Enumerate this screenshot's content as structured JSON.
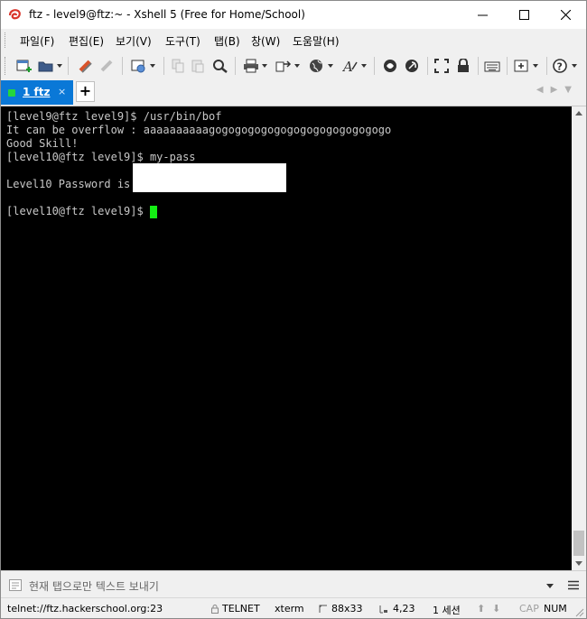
{
  "window": {
    "title": "ftz - level9@ftz:~ - Xshell 5 (Free for Home/School)"
  },
  "menu": {
    "items": [
      "파일(F)",
      "편집(E)",
      "보기(V)",
      "도구(T)",
      "탭(B)",
      "창(W)",
      "도움말(H)"
    ]
  },
  "toolbar": {
    "icons": [
      "new-session-icon",
      "open-folder-icon",
      "reconnect-icon",
      "disconnect-icon",
      "properties-icon",
      "copy-icon",
      "paste-icon",
      "find-icon",
      "print-icon",
      "transfer-icon",
      "globe-icon",
      "font-icon",
      "xftp-icon",
      "xmanager-icon",
      "fullscreen-icon",
      "lock-icon",
      "keyboard-icon",
      "new-tab-icon",
      "help-icon"
    ]
  },
  "tabs": {
    "active_label": "1 ftz",
    "close_glyph": "×",
    "add_glyph": "+"
  },
  "terminal": {
    "lines": [
      "[level9@ftz level9]$ /usr/bin/bof",
      "It can be overflow : aaaaaaaaaagogogogogogogogogogogogogogo",
      "Good Skill!",
      "[level10@ftz level9]$ my-pass",
      "",
      "Level10 Password is ",
      "",
      "[level10@ftz level9]$ "
    ],
    "colors": {
      "background": "#000000",
      "text": "#c8c8c8",
      "cursor": "#14ee14"
    }
  },
  "compose": {
    "placeholder": "현재 탭으로만 텍스트 보내기"
  },
  "status": {
    "connection": "telnet://ftz.hackerschool.org:23",
    "protocol": "TELNET",
    "terminal_type": "xterm",
    "size": "88x33",
    "cursor_pos": "4,23",
    "sessions": "1 세션",
    "caps": "CAP",
    "num": "NUM"
  },
  "colors": {
    "tab_active": "#0a78d7",
    "tab_indicator": "#25d63c"
  }
}
